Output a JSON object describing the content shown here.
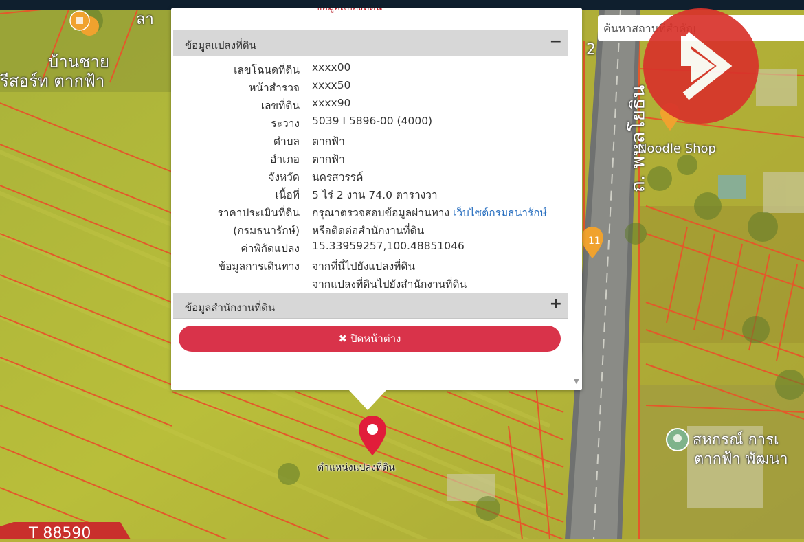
{
  "map": {
    "labels": {
      "village": "บ้านชาย",
      "resort": "รีสอร์ท ตากฟ้า",
      "road": "ถ. พหลโยธิน",
      "shop": "Noodle Shop",
      "coop_line1": "สหกรณ์ การเ",
      "coop_line2": "ตากฟ้า พัฒนา",
      "top_left_fragment": "ลา",
      "road_number": "2"
    },
    "search": {
      "placeholder": "ค้นหาสถานที่สำคัญ"
    },
    "marker_label": "ตำแหน่งแปลงที่ดิน",
    "bottom_badge": "T 88590"
  },
  "popup": {
    "top_cut_text": "ข้อมูลแปลงที่ดิน",
    "section_parcel": {
      "title": "ข้อมูลแปลงที่ดิน",
      "toggle": "−"
    },
    "details": [
      {
        "label": "เลขโฉนดที่ดิน",
        "value": "xxxx00"
      },
      {
        "label": "หน้าสำรวจ",
        "value": "xxxx50"
      },
      {
        "label": "เลขที่ดิน",
        "value": "xxxx90"
      },
      {
        "label": "ระวาง",
        "value": "5039 I 5896-00 (4000)"
      },
      {
        "label": "ตำบล",
        "value": "ตากฟ้า"
      },
      {
        "label": "อำเภอ",
        "value": "ตากฟ้า"
      },
      {
        "label": "จังหวัด",
        "value": "นครสวรรค์"
      },
      {
        "label": "เนื้อที่",
        "value": "5 ไร่ 2 งาน 74.0 ตารางวา"
      }
    ],
    "appraisal": {
      "label1": "ราคาประเมินที่ดิน",
      "label2": "(กรมธนารักษ์)",
      "text1": "กรุณาตรวจสอบข้อมูลผ่านทาง",
      "link": "เว็บไซต์กรมธนารักษ์",
      "text2": "หรือติดต่อสำนักงานที่ดิน"
    },
    "coords": {
      "label": "ค่าพิกัดแปลง",
      "value": "15.33959257,100.48851046"
    },
    "travel": {
      "label": "ข้อมูลการเดินทาง",
      "link1": "จากที่นี่ไปยังแปลงที่ดิน",
      "link2": "จากแปลงที่ดินไปยังสำนักงานที่ดิน"
    },
    "section_office": {
      "title": "ข้อมูลสำนักงานที่ดิน",
      "toggle": "+"
    },
    "close_button": {
      "icon": "✖",
      "label": "ปิดหน้าต่าง"
    }
  },
  "colors": {
    "accent_red": "#d9334a",
    "link_blue": "#2a70c0",
    "logo_red": "#d8332b"
  }
}
